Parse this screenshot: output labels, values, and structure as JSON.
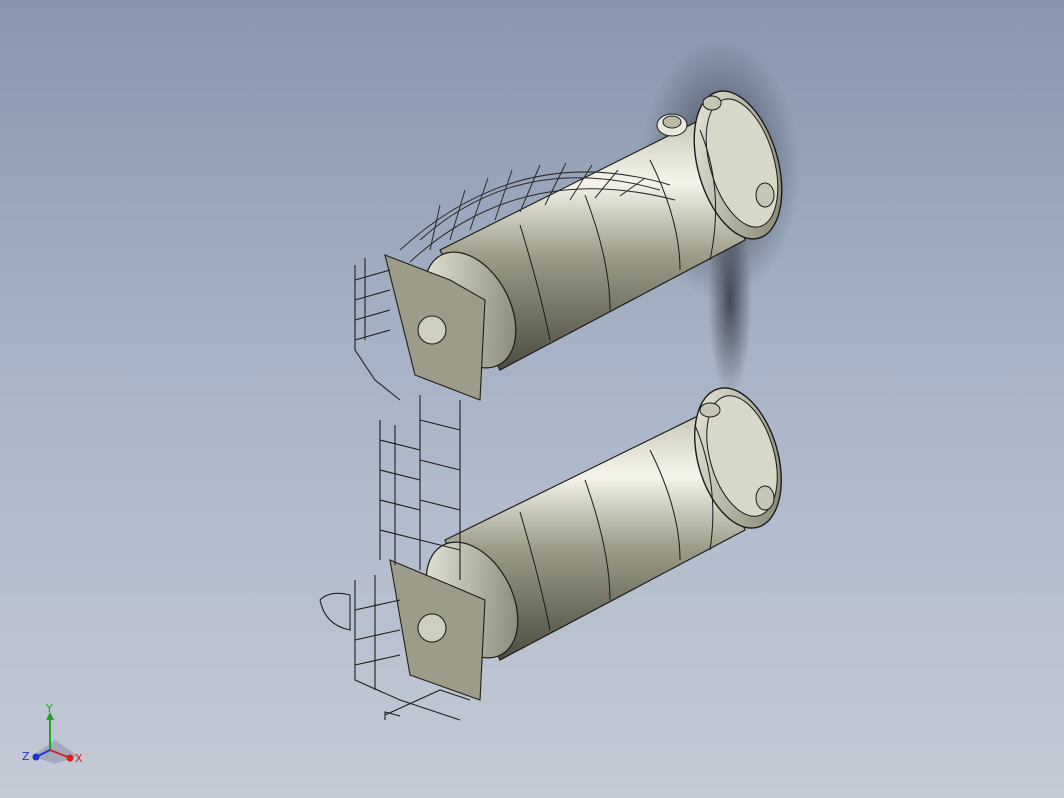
{
  "viewport": {
    "colors": {
      "bg_top": "#8796ae",
      "bg_bottom": "#c4cad6",
      "shell": "#8e8e78",
      "edge": "#1b1b1b",
      "shadow": "#2a2f3a"
    }
  },
  "triad": {
    "x_label": "X",
    "y_label": "Y",
    "z_label": "Z",
    "colors": {
      "x": "#d32020",
      "y": "#1aa61a",
      "z": "#2233cc"
    }
  }
}
